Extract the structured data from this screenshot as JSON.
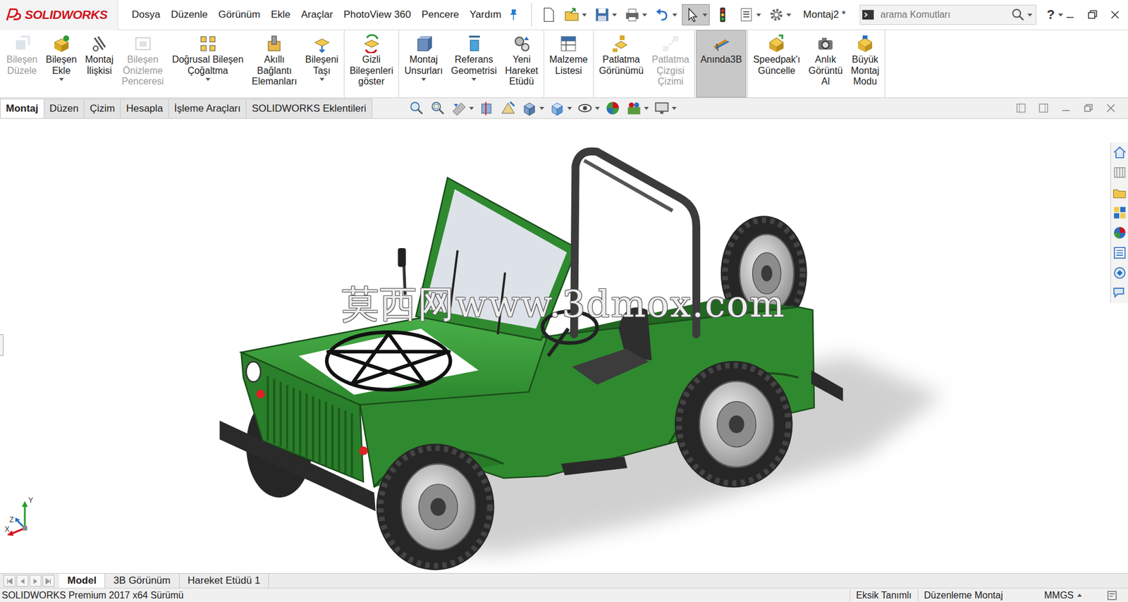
{
  "app": {
    "logo": "SOLIDWORKS",
    "document_title": "Montaj2 *"
  },
  "menu": [
    "Dosya",
    "Düzenle",
    "Görünüm",
    "Ekle",
    "Araçlar",
    "PhotoView 360",
    "Pencere",
    "Yardım"
  ],
  "quick_access": [
    {
      "selected": false
    },
    {
      "selected": false
    },
    {
      "selected": false
    },
    {
      "selected": false
    },
    {
      "selected": false
    },
    {
      "selected": true
    },
    {
      "selected": false
    },
    {
      "selected": false
    },
    {
      "selected": false
    }
  ],
  "search": {
    "placeholder": "arama Komutları"
  },
  "help": "?",
  "ribbon": {
    "groups": [
      [
        {
          "label": [
            "Bileşen",
            "Düzele"
          ],
          "disabled": true,
          "dropdown": false,
          "selected": false
        },
        {
          "label": [
            "Bileşen",
            "Ekle"
          ],
          "disabled": false,
          "dropdown": true,
          "selected": false
        },
        {
          "label": [
            "Montaj",
            "İlişkisi"
          ],
          "disabled": false,
          "dropdown": false,
          "selected": false
        },
        {
          "label": [
            "Bileşen",
            "Önizleme",
            "Penceresi"
          ],
          "disabled": true,
          "dropdown": false,
          "selected": false
        },
        {
          "label": [
            "Doğrusal Bileşen",
            "Çoğaltma"
          ],
          "disabled": false,
          "dropdown": true,
          "selected": false
        },
        {
          "label": [
            "Akıllı",
            "Bağlantı",
            "Elemanları"
          ],
          "disabled": false,
          "dropdown": false,
          "selected": false
        },
        {
          "label": [
            "Bileşeni",
            "Taşı"
          ],
          "disabled": false,
          "dropdown": true,
          "selected": false
        }
      ],
      [
        {
          "label": [
            "Gizli",
            "Bileşenleri",
            "göster"
          ],
          "disabled": false,
          "dropdown": false,
          "selected": false
        }
      ],
      [
        {
          "label": [
            "Montaj",
            "Unsurları"
          ],
          "disabled": false,
          "dropdown": true,
          "selected": false
        },
        {
          "label": [
            "Referans",
            "Geometrisi"
          ],
          "disabled": false,
          "dropdown": true,
          "selected": false
        },
        {
          "label": [
            "Yeni",
            "Hareket",
            "Etüdü"
          ],
          "disabled": false,
          "dropdown": false,
          "selected": false
        }
      ],
      [
        {
          "label": [
            "Malzeme",
            "Listesi"
          ],
          "disabled": false,
          "dropdown": false,
          "selected": false
        }
      ],
      [
        {
          "label": [
            "Patlatma",
            "Görünümü"
          ],
          "disabled": false,
          "dropdown": false,
          "selected": false
        },
        {
          "label": [
            "Patlatma",
            "Çizgisi",
            "Çizimi"
          ],
          "disabled": true,
          "dropdown": false,
          "selected": false
        }
      ],
      [
        {
          "label": [
            "Anında3B"
          ],
          "disabled": false,
          "dropdown": false,
          "selected": true
        }
      ],
      [
        {
          "label": [
            "Speedpak'ı",
            "Güncelle"
          ],
          "disabled": false,
          "dropdown": false,
          "selected": false
        },
        {
          "label": [
            "Anlık",
            "Görüntü",
            "Al"
          ],
          "disabled": false,
          "dropdown": false,
          "selected": false
        },
        {
          "label": [
            "Büyük",
            "Montaj",
            "Modu"
          ],
          "disabled": false,
          "dropdown": false,
          "selected": false
        }
      ]
    ]
  },
  "tabs": [
    {
      "label": "Montaj",
      "selected": true
    },
    {
      "label": "Düzen",
      "selected": false
    },
    {
      "label": "Çizim",
      "selected": false
    },
    {
      "label": "Hesapla",
      "selected": false
    },
    {
      "label": "İşleme Araçları",
      "selected": false
    },
    {
      "label": "SOLIDWORKS Eklentileri",
      "selected": false
    }
  ],
  "watermark": "莫西网www.3dmox.com",
  "triad": {
    "x": "X",
    "y": "Y",
    "z": "Z"
  },
  "bottom_tabs": [
    {
      "label": "Model",
      "selected": true
    },
    {
      "label": "3B Görünüm",
      "selected": false
    },
    {
      "label": "Hareket Etüdü 1",
      "selected": false
    }
  ],
  "status_bar": {
    "left": "SOLIDWORKS Premium 2017 x64 Sürümü",
    "items": [
      "Eksik Tanımlı",
      "Düzenleme Montaj"
    ],
    "units": "MMGS"
  }
}
